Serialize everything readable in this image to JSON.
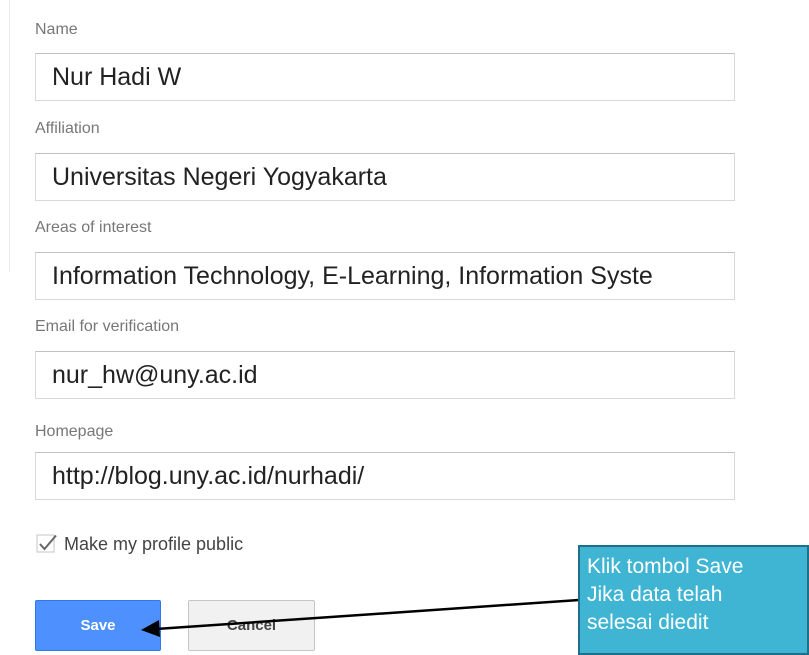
{
  "form": {
    "name": {
      "label": "Name",
      "value": "Nur Hadi W"
    },
    "affiliation": {
      "label": "Affiliation",
      "value": "Universitas Negeri Yogyakarta"
    },
    "interests": {
      "label": "Areas of interest",
      "value": "Information Technology, E-Learning, Information Syste"
    },
    "email": {
      "label": "Email for verification",
      "value": "nur_hw@uny.ac.id"
    },
    "homepage": {
      "label": "Homepage",
      "value": "http://blog.uny.ac.id/nurhadi/"
    },
    "public_profile": {
      "label": "Make my profile public",
      "checked": true,
      "icon": "checkmark-icon"
    }
  },
  "buttons": {
    "save": "Save",
    "cancel": "Cancel"
  },
  "annotation": {
    "lines": [
      "Klik tombol Save",
      "Jika data telah",
      "selesai diedit"
    ],
    "bg_color": "#3fb5d3"
  },
  "colors": {
    "primary": "#4d90fe",
    "label": "#777777"
  }
}
